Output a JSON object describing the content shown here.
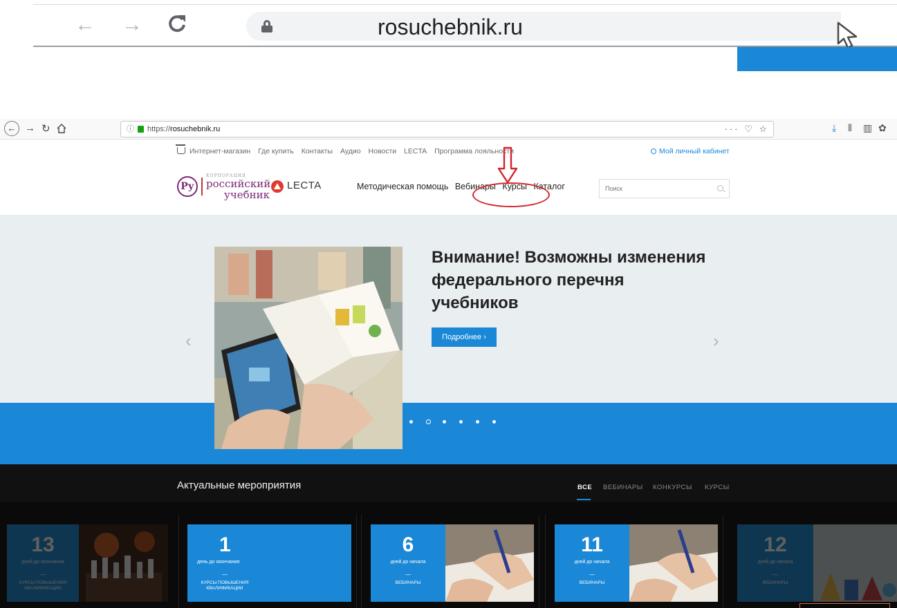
{
  "zoom_bar": {
    "url": "rosuchebnik.ru",
    "back_glyph": "←",
    "forward_glyph": "→",
    "reload_glyph": "C"
  },
  "browser": {
    "url_scheme": "https://",
    "url_host": "rosuchebnik.ru",
    "info_glyph": "ⓘ",
    "page_actions": "··· ♡ ☆",
    "toolbar_icons": [
      "download-icon",
      "library-icon",
      "sidebar-icon",
      "extension-icon"
    ]
  },
  "site": {
    "top_links": [
      "Интернет-магазин",
      "Где купить",
      "Контакты",
      "Аудио",
      "Новости",
      "LECTA",
      "Программа лояльности"
    ],
    "cabinet": "Мой личный кабинет",
    "logo": {
      "mark": "Ру",
      "small": "КОРПОРАЦИЯ",
      "line1": "российский",
      "line2": "учебник",
      "lecta": "LECTA"
    },
    "nav": [
      "Методическая помощь",
      "Вебинары",
      "Курсы",
      "Каталог"
    ],
    "search_placeholder": "Поиск"
  },
  "hero": {
    "title": "Внимание! Возможны изменения федерального перечня учебников",
    "button": "Подробнее ›",
    "prev": "‹",
    "next": "›",
    "slide_count": 6,
    "active_slide": 2
  },
  "events": {
    "title": "Актуальные мероприятия",
    "filters": [
      "ВСЕ",
      "ВЕБИНАРЫ",
      "КОНКУРСЫ",
      "КУРСЫ"
    ],
    "active_filter": "ВСЕ",
    "cards": [
      {
        "num": "13",
        "label": "дней до окончания",
        "category": "курсы повышения квалификации",
        "dim": true
      },
      {
        "num": "1",
        "label": "день до окончания",
        "category": "курсы повышения квалификации",
        "dim": false
      },
      {
        "num": "6",
        "label": "дней до начала",
        "category": "вебинары",
        "dim": false
      },
      {
        "num": "11",
        "label": "дней до начала",
        "category": "вебинары",
        "dim": false
      },
      {
        "num": "12",
        "label": "дней до начала",
        "category": "вебинары",
        "dim": true
      }
    ]
  },
  "colors": {
    "accent": "#1a88d6",
    "annotation": "#d3242d",
    "logo": "#7a2a74",
    "lecta": "#e03a2f"
  }
}
